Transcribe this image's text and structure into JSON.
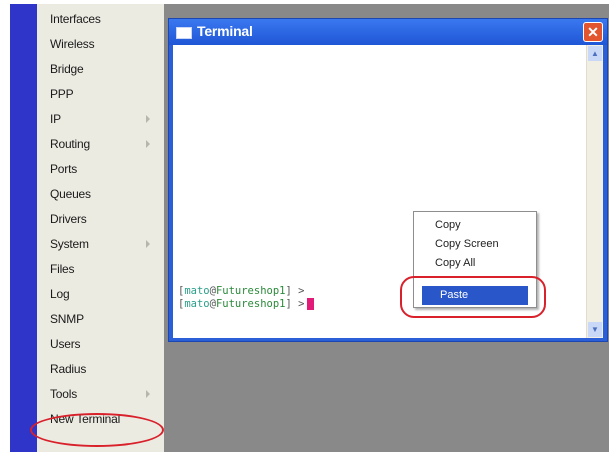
{
  "left_menu": {
    "items": [
      {
        "label": "Interfaces",
        "submenu": false
      },
      {
        "label": "Wireless",
        "submenu": false
      },
      {
        "label": "Bridge",
        "submenu": false
      },
      {
        "label": "PPP",
        "submenu": false
      },
      {
        "label": "IP",
        "submenu": true
      },
      {
        "label": "Routing",
        "submenu": true
      },
      {
        "label": "Ports",
        "submenu": false
      },
      {
        "label": "Queues",
        "submenu": false
      },
      {
        "label": "Drivers",
        "submenu": false
      },
      {
        "label": "System",
        "submenu": true
      },
      {
        "label": "Files",
        "submenu": false
      },
      {
        "label": "Log",
        "submenu": false
      },
      {
        "label": "SNMP",
        "submenu": false
      },
      {
        "label": "Users",
        "submenu": false
      },
      {
        "label": "Radius",
        "submenu": false
      },
      {
        "label": "Tools",
        "submenu": true
      },
      {
        "label": "New Terminal",
        "submenu": false
      }
    ]
  },
  "terminal_window": {
    "title": "Terminal",
    "close_symbol": "✕",
    "lines": [
      {
        "open": "[",
        "user": "mato",
        "at": "@",
        "host": "Futureshop1",
        "close": "] >"
      },
      {
        "open": "[",
        "user": "mato",
        "at": "@",
        "host": "Futureshop1",
        "close": "] >"
      }
    ]
  },
  "context_menu": {
    "items": [
      "Copy",
      "Copy Screen",
      "Copy All"
    ],
    "selected_item": "Paste"
  },
  "colors": {
    "menu_bar": "#2f35c9",
    "highlight_ellipse": "#d9212c",
    "selected_item": "#2956c8"
  },
  "icons": {
    "submenu_arrow": "chevron-right-icon",
    "window_icon": "terminal-window-icon",
    "close": "close-icon"
  }
}
